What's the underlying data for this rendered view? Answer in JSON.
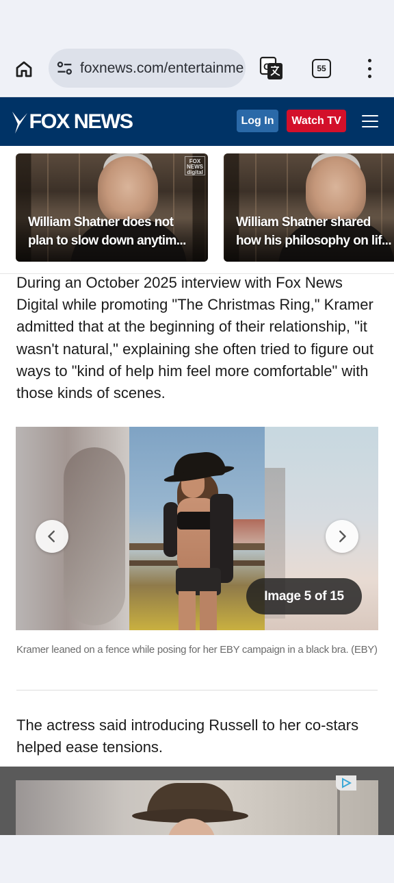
{
  "browser": {
    "url": "foxnews.com/entertainme",
    "tab_count": "55",
    "icons": [
      "home-icon",
      "site-settings-icon",
      "translate-icon",
      "tab-switcher-icon",
      "more-vert-icon"
    ]
  },
  "site_header": {
    "logo_text": "FOX NEWS",
    "login_label": "Log In",
    "watch_tv_label": "Watch TV",
    "brand_color": "#003366",
    "watch_color": "#d3102a",
    "login_color": "#2a69a8"
  },
  "video_cards": [
    {
      "title_line1": "William Shatner does not",
      "title_line2": "plan to slow down anytim...",
      "watermark": "FOX NEWS digital"
    },
    {
      "title_line1": "William Shatner shared",
      "title_line2": "how his philosophy on lif...",
      "watermark": ""
    }
  ],
  "article": {
    "paragraph1": "During an October 2025 interview with Fox News Digital while promoting \"The Christmas Ring,\" Kramer admitted that at the beginning of their relationship, \"it wasn't natural,\" explaining she often tried to figure out ways to \"kind of help him feel more comfortable\" with those kinds of scenes.",
    "gallery": {
      "counter": "Image 5 of 15",
      "current": 5,
      "total": 15,
      "caption": "Kramer leaned on a fence while posing for her EBY campaign in a black bra. (EBY)"
    },
    "paragraph2": "The actress said introducing Russell to her co-stars helped ease tensions."
  }
}
